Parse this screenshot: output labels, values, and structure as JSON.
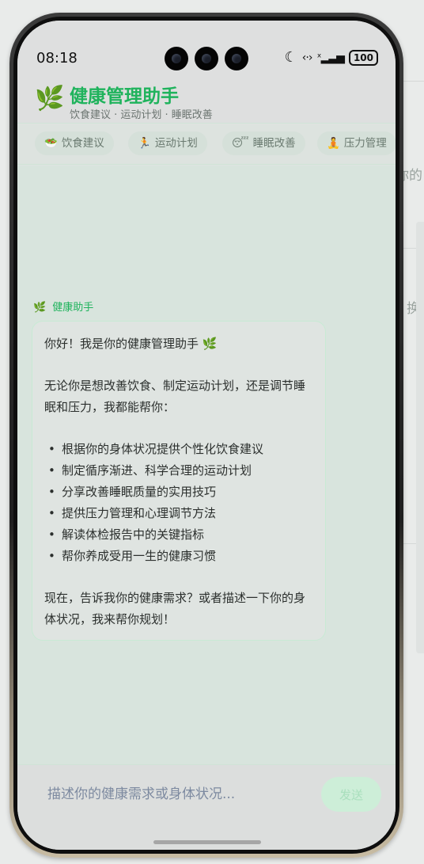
{
  "background_app": {
    "text_1": "你的",
    "text_2": "换"
  },
  "status_bar": {
    "time": "08:18",
    "battery": "100"
  },
  "header": {
    "logo_icon": "🌿",
    "title": "健康管理助手",
    "subtitle": "饮食建议 · 运动计划 · 睡眠改善"
  },
  "chips": [
    {
      "icon": "🥗",
      "label": "饮食建议"
    },
    {
      "icon": "🏃",
      "label": "运动计划"
    },
    {
      "icon": "😴",
      "label": "睡眠改善"
    },
    {
      "icon": "🧘",
      "label": "压力管理"
    }
  ],
  "chat": {
    "bot_icon": "🌿",
    "bot_name": "健康助手",
    "message": {
      "greeting": "你好！我是你的健康管理助手 🌿",
      "intro": "无论你是想改善饮食、制定运动计划，还是调节睡眠和压力，我都能帮你：",
      "items": [
        "根据你的身体状况提供个性化饮食建议",
        "制定循序渐进、科学合理的运动计划",
        "分享改善睡眠质量的实用技巧",
        "提供压力管理和心理调节方法",
        "解读体检报告中的关键指标",
        "帮你养成受用一生的健康习惯"
      ],
      "closing": "现在，告诉我你的健康需求？或者描述一下你的身体状况，我来帮你规划！"
    }
  },
  "input": {
    "placeholder": "描述你的健康需求或身体状况...",
    "value": "",
    "send_label": "发送"
  },
  "colors": {
    "accent": "#1fb35c",
    "chat_background": "#d8e4dd",
    "bubble_border": "#c8ead4",
    "send_button": "#cdeed8"
  }
}
